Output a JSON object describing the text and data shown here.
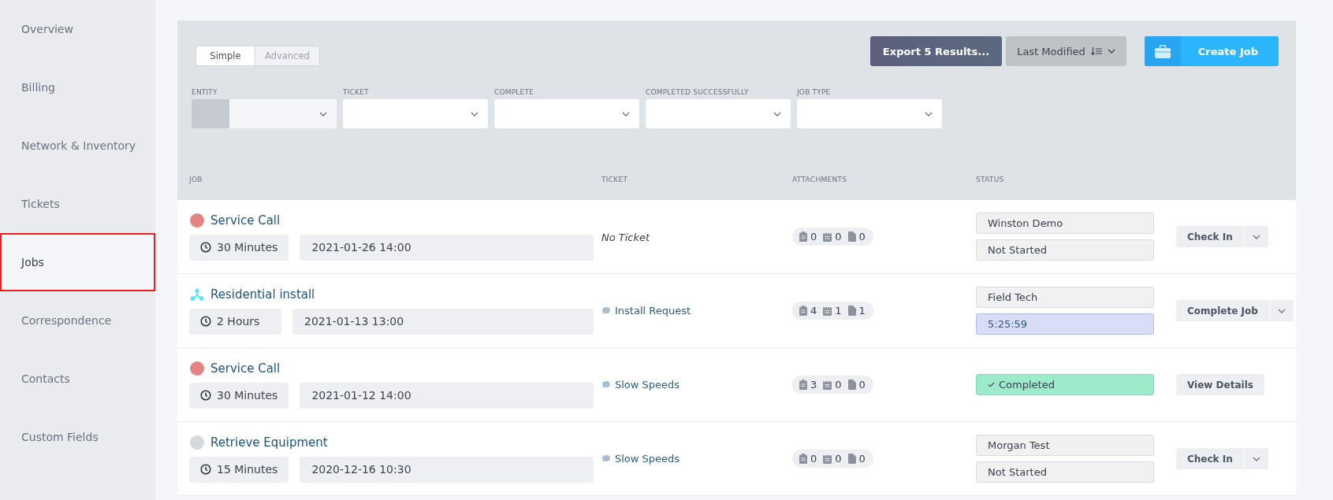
{
  "sidebar": {
    "items": [
      {
        "label": "Overview",
        "selected": false
      },
      {
        "label": "Billing",
        "selected": false
      },
      {
        "label": "Network & Inventory",
        "selected": false
      },
      {
        "label": "Tickets",
        "selected": false
      },
      {
        "label": "Jobs",
        "selected": true
      },
      {
        "label": "Correspondence",
        "selected": false
      },
      {
        "label": "Contacts",
        "selected": false
      },
      {
        "label": "Custom Fields",
        "selected": false
      }
    ]
  },
  "mode_toggle": [
    {
      "label": "Simple",
      "selected": true
    },
    {
      "label": "Advanced",
      "selected": false
    }
  ],
  "toolbar": {
    "export_button": "Export 5 Results...",
    "sort": {
      "label": "Last Modified"
    },
    "create_button": "Create Job"
  },
  "filters": [
    {
      "label": "ENTITY",
      "kind": "entity"
    },
    {
      "label": "TICKET",
      "kind": "select"
    },
    {
      "label": "COMPLETE",
      "kind": "select"
    },
    {
      "label": "COMPLETED SUCCESSFULLY",
      "kind": "select"
    },
    {
      "label": "JOB TYPE",
      "kind": "select"
    }
  ],
  "table": {
    "columns": [
      "JOB",
      "TICKET",
      "ATTACHMENTS",
      "STATUS"
    ],
    "rows": [
      {
        "job": {
          "title": "Service Call",
          "kind": "dot",
          "color": "#e58383",
          "duration": "30 Minutes",
          "date": "2021-01-26 14:00"
        },
        "ticket": {
          "kind": "none",
          "text": "No Ticket"
        },
        "attachments": [
          "0",
          "0",
          "0"
        ],
        "status": [
          {
            "kind": "plain",
            "text": "Winston Demo"
          },
          {
            "kind": "plain",
            "text": "Not Started"
          }
        ],
        "action": {
          "label": "Check In",
          "has_menu": true
        }
      },
      {
        "job": {
          "title": "Residential install",
          "kind": "network",
          "color": "#4ee8f0",
          "duration": "2 Hours",
          "date": "2021-01-13 13:00"
        },
        "ticket": {
          "kind": "link",
          "text": "Install Request"
        },
        "attachments": [
          "4",
          "1",
          "1"
        ],
        "status": [
          {
            "kind": "plain",
            "text": "Field Tech"
          },
          {
            "kind": "timer",
            "text": "5:25:59"
          }
        ],
        "action": {
          "label": "Complete Job",
          "has_menu": true
        }
      },
      {
        "job": {
          "title": "Service Call",
          "kind": "dot",
          "color": "#e58383",
          "duration": "30 Minutes",
          "date": "2021-01-12 14:00"
        },
        "ticket": {
          "kind": "link",
          "text": "Slow Speeds"
        },
        "attachments": [
          "3",
          "0",
          "0"
        ],
        "status": [
          {
            "kind": "completed",
            "text": "Completed"
          }
        ],
        "action": {
          "label": "View Details",
          "has_menu": false
        }
      },
      {
        "job": {
          "title": "Retrieve Equipment",
          "kind": "dot",
          "color": "#d4d8dc",
          "duration": "15 Minutes",
          "date": "2020-12-16 10:30"
        },
        "ticket": {
          "kind": "link",
          "text": "Slow Speeds"
        },
        "attachments": [
          "0",
          "0",
          "0"
        ],
        "status": [
          {
            "kind": "plain",
            "text": "Morgan Test"
          },
          {
            "kind": "plain",
            "text": "Not Started"
          }
        ],
        "action": {
          "label": "Check In",
          "has_menu": true
        }
      }
    ]
  }
}
